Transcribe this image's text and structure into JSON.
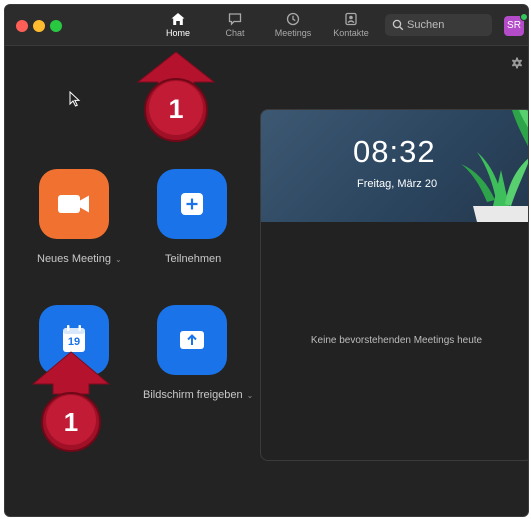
{
  "nav": {
    "tabs": [
      {
        "label": "Home",
        "active": true
      },
      {
        "label": "Chat"
      },
      {
        "label": "Meetings"
      },
      {
        "label": "Kontakte"
      }
    ]
  },
  "search": {
    "placeholder": "Suchen"
  },
  "profile": {
    "initials": "SR"
  },
  "actions": {
    "new_meeting": "Neues Meeting",
    "join": "Teilnehmen",
    "schedule_day": "19",
    "share_screen": "Bildschirm freigeben"
  },
  "calendar_card": {
    "time": "08:32",
    "date": "Freitag, März 20",
    "empty_message": "Keine bevorstehenden Meetings heute"
  },
  "annotations": {
    "callout_number": "1",
    "callout_color": "#b5122d"
  },
  "colors": {
    "accent_blue": "#1a73e8",
    "accent_orange": "#f17130"
  }
}
